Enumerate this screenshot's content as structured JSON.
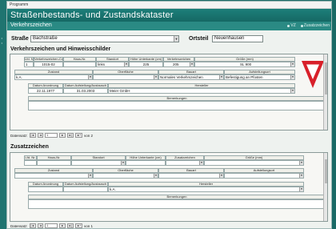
{
  "menu_label": "Programm",
  "title": "Straßenbestands- und Zustandskataster",
  "subtitle": "Verkehrszeichen",
  "flags": [
    "VZ",
    "Zusatzzeichen"
  ],
  "left_dots": "·\n·",
  "strasse_label": "Straße",
  "strasse_value": "Bachstraße",
  "ortsteil_label": "Ortsteil",
  "ortsteil_value": "Neuenhausen",
  "section1_title": "Verkehrszeichen und Hinweisschilder",
  "section2_title": "Zusatzzeichen",
  "s1": {
    "headers_row1": [
      "Lfd. Nr.",
      "Verkehrszeichen-Code",
      "Haus-Nr.",
      "Standort",
      "Höhe Unterkante (cm)",
      "Verkehrszeichen",
      "Größe (mm)"
    ],
    "values_row1": [
      "1",
      "1015-02",
      "",
      "links",
      "225",
      "205",
      "SL 900"
    ],
    "headers_row2": [
      "Zustand",
      "Oberfläche",
      "Bauart",
      "Aufstellungsort"
    ],
    "values_row2": [
      "k.A.",
      "",
      "Normales Verkehrszeichen",
      "Befestigung an Pfosten"
    ],
    "headers_row3": [
      "Datum Anordnung",
      "Datum Aufstellung/Austausch",
      "Hersteller"
    ],
    "values_row3": [
      "22.11.1977",
      "31.03.2003",
      "Meier GmbH"
    ],
    "bemerkungen_label": "Bemerkungen",
    "pager": {
      "label": "Datensatz:",
      "first": "|◄",
      "prev": "◄",
      "current": "1",
      "next": "►",
      "last": "►|",
      "new": "►*",
      "total_text": "von 2"
    }
  },
  "s2": {
    "headers_row1": [
      "Lfd. Nr.",
      "Haus-Nr.",
      "Standort",
      "Höhe Unterkante (cm)",
      "Zusatzzeichen",
      "Größe (mm)"
    ],
    "headers_row2": [
      "Zustand",
      "Oberfläche",
      "Bauart",
      "Aufstellungsort"
    ],
    "headers_row3": [
      "Datum Anordnung",
      "Datum Aufstellung/Austausch",
      "Hersteller"
    ],
    "values_row3": [
      "",
      "",
      "k.A."
    ],
    "bemerkungen_label": "Bemerkungen",
    "pager": {
      "label": "Datensatz:",
      "first": "|◄",
      "prev": "◄",
      "current": "1",
      "next": "►",
      "last": "►|",
      "new": "►*",
      "total_text": "von 1"
    }
  },
  "sign": {
    "type": "yield-sign",
    "border_color": "#d8202a",
    "fill_color": "#ffffff"
  }
}
